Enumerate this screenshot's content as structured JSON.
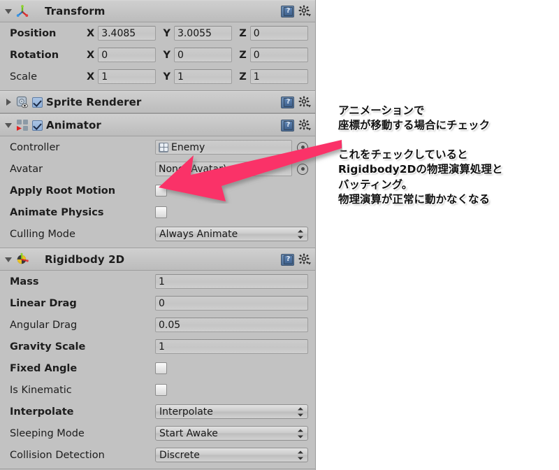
{
  "inspector": {
    "components": [
      {
        "id": "transform",
        "title": "Transform",
        "icon": "transform-axes-icon",
        "expanded": true,
        "has_enable_checkbox": false,
        "help_icon": "help-book-icon",
        "gear_icon": "gear-icon",
        "rows": [
          {
            "label": "Position",
            "bold": true,
            "type": "vector3",
            "axes": [
              "X",
              "Y",
              "Z"
            ],
            "values": [
              "3.4085",
              "3.0055",
              "0"
            ]
          },
          {
            "label": "Rotation",
            "bold": true,
            "type": "vector3",
            "axes": [
              "X",
              "Y",
              "Z"
            ],
            "values": [
              "0",
              "0",
              "0"
            ]
          },
          {
            "label": "Scale",
            "bold": false,
            "type": "vector3",
            "axes": [
              "X",
              "Y",
              "Z"
            ],
            "values": [
              "1",
              "1",
              "1"
            ]
          }
        ]
      },
      {
        "id": "sprite-renderer",
        "title": "Sprite Renderer",
        "icon": "sprite-renderer-icon",
        "expanded": false,
        "has_enable_checkbox": true,
        "enabled": true,
        "help_icon": "help-book-icon",
        "gear_icon": "gear-icon",
        "rows": []
      },
      {
        "id": "animator",
        "title": "Animator",
        "icon": "animator-icon",
        "expanded": true,
        "has_enable_checkbox": true,
        "enabled": true,
        "help_icon": "help-book-icon",
        "gear_icon": "gear-icon",
        "rows": [
          {
            "label": "Controller",
            "bold": false,
            "type": "object",
            "value": "Enemy",
            "asset_icon": "animator-controller-icon",
            "picker": "object-picker-icon"
          },
          {
            "label": "Avatar",
            "bold": false,
            "type": "object",
            "value": "None (Avatar)",
            "asset_icon": "",
            "picker": "object-picker-icon"
          },
          {
            "label": "Apply Root Motion",
            "bold": true,
            "type": "checkbox",
            "checked": false
          },
          {
            "label": "Animate Physics",
            "bold": true,
            "type": "checkbox",
            "checked": false
          },
          {
            "label": "Culling Mode",
            "bold": false,
            "type": "popup",
            "value": "Always Animate"
          }
        ]
      },
      {
        "id": "rigidbody-2d",
        "title": "Rigidbody 2D",
        "icon": "rigidbody2d-icon",
        "expanded": true,
        "has_enable_checkbox": false,
        "help_icon": "help-book-icon",
        "gear_icon": "gear-icon",
        "rows": [
          {
            "label": "Mass",
            "bold": true,
            "type": "text",
            "value": "1"
          },
          {
            "label": "Linear Drag",
            "bold": true,
            "type": "text",
            "value": "0"
          },
          {
            "label": "Angular Drag",
            "bold": false,
            "type": "text",
            "value": "0.05"
          },
          {
            "label": "Gravity Scale",
            "bold": true,
            "type": "text",
            "value": "1"
          },
          {
            "label": "Fixed Angle",
            "bold": true,
            "type": "checkbox",
            "checked": false
          },
          {
            "label": "Is Kinematic",
            "bold": false,
            "type": "checkbox",
            "checked": false
          },
          {
            "label": "Interpolate",
            "bold": true,
            "type": "popup",
            "value": "Interpolate"
          },
          {
            "label": "Sleeping Mode",
            "bold": false,
            "type": "popup",
            "value": "Start Awake"
          },
          {
            "label": "Collision Detection",
            "bold": false,
            "type": "popup",
            "value": "Discrete"
          }
        ]
      }
    ]
  },
  "annotations": {
    "top": "アニメーションで\n座標が移動する場合にチェック",
    "bottom": "これをチェックしていると\nRigidbody2Dの物理演算処理と\nバッティング。\n物理演算が正常に動かなくなる",
    "arrow": {
      "name": "pointer-arrow",
      "color": "#fa3367",
      "points_to": "apply-root-motion-checkbox"
    }
  },
  "colors": {
    "panel_bg": "#c2c2c2",
    "header_bg": "#cacaca",
    "field_bg": "#cacaca",
    "arrow": "#fa3367",
    "checkbox_on": "#8fb0da"
  }
}
